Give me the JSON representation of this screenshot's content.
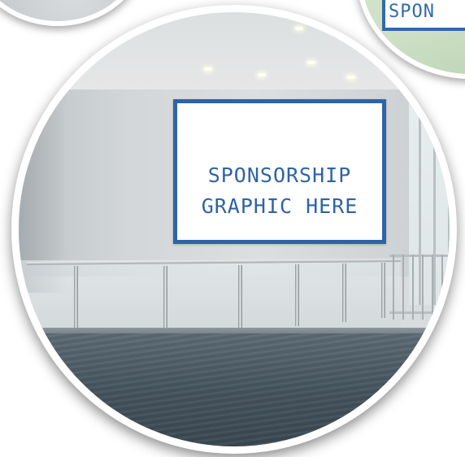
{
  "sign": {
    "line1": "SPONSORSHIP",
    "line2": "GRAPHIC HERE",
    "border_color": "#2f63a6",
    "text_color": "#2f63a6"
  },
  "partial_sign": {
    "text": "SPON"
  },
  "colors": {
    "frame": "#ffffff",
    "floor": "#44525c",
    "wall": "#d6dadc"
  }
}
